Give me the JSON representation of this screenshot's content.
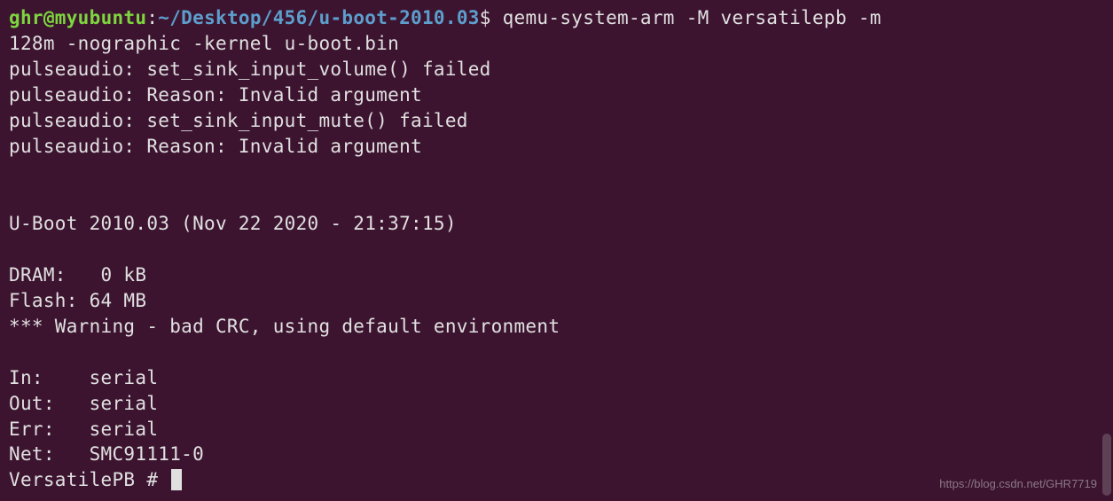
{
  "prompt": {
    "user": "ghr",
    "at": "@",
    "host": "myubuntu",
    "colon": ":",
    "path": "~/Desktop/456/u-boot-2010.03",
    "dollar": "$",
    "command_part1": " qemu-system-arm -M versatilepb -m ",
    "command_part2": "128m -nographic -kernel u-boot.bin"
  },
  "output": {
    "l1": "pulseaudio: set_sink_input_volume() failed",
    "l2": "pulseaudio: Reason: Invalid argument",
    "l3": "pulseaudio: set_sink_input_mute() failed",
    "l4": "pulseaudio: Reason: Invalid argument",
    "blank1": "",
    "blank2": "",
    "uboot": "U-Boot 2010.03 (Nov 22 2020 - 21:37:15)",
    "blank3": "",
    "dram": "DRAM:   0 kB",
    "flash": "Flash: 64 MB",
    "warn": "*** Warning - bad CRC, using default environment",
    "blank4": "",
    "in": "In:    serial",
    "out": "Out:   serial",
    "err": "Err:   serial",
    "net": "Net:   SMC91111-0",
    "shell": "VersatilePB # "
  },
  "watermark": "https://blog.csdn.net/GHR7719"
}
